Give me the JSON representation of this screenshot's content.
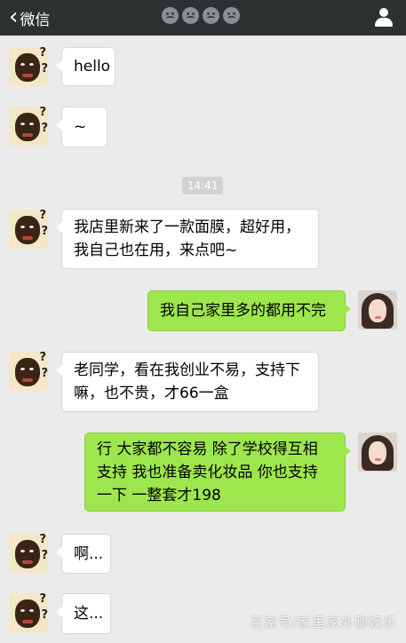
{
  "header": {
    "back_label": "微信",
    "emoji_icons": [
      "face-icon",
      "face-icon",
      "face-icon",
      "face-icon"
    ],
    "profile_icon": "person-icon"
  },
  "timestamp": "14:41",
  "messages": [
    {
      "side": "left",
      "text": "hello"
    },
    {
      "side": "left",
      "text": "~"
    },
    {
      "side": "left",
      "text": "我店里新来了一款面膜，超好用，\n我自己也在用，来点吧~"
    },
    {
      "side": "right",
      "text": "我自己家里多的都用不完"
    },
    {
      "side": "left",
      "text": "老同学，看在我创业不易，支持下\n嘛，也不贵，才66一盒"
    },
    {
      "side": "right",
      "text": "行 大家都不容易 除了学校得互相\n支持 我也准备卖化妆品 你也支持\n一下 一整套才198"
    },
    {
      "side": "left",
      "text": "啊..."
    },
    {
      "side": "left",
      "text": "这..."
    }
  ],
  "watermark": "百家号/家里家外聊娱乐",
  "colors": {
    "topbar": "#2e3132",
    "background": "#ebebeb",
    "outgoing_bubble": "#9ee64e",
    "incoming_bubble": "#ffffff"
  }
}
